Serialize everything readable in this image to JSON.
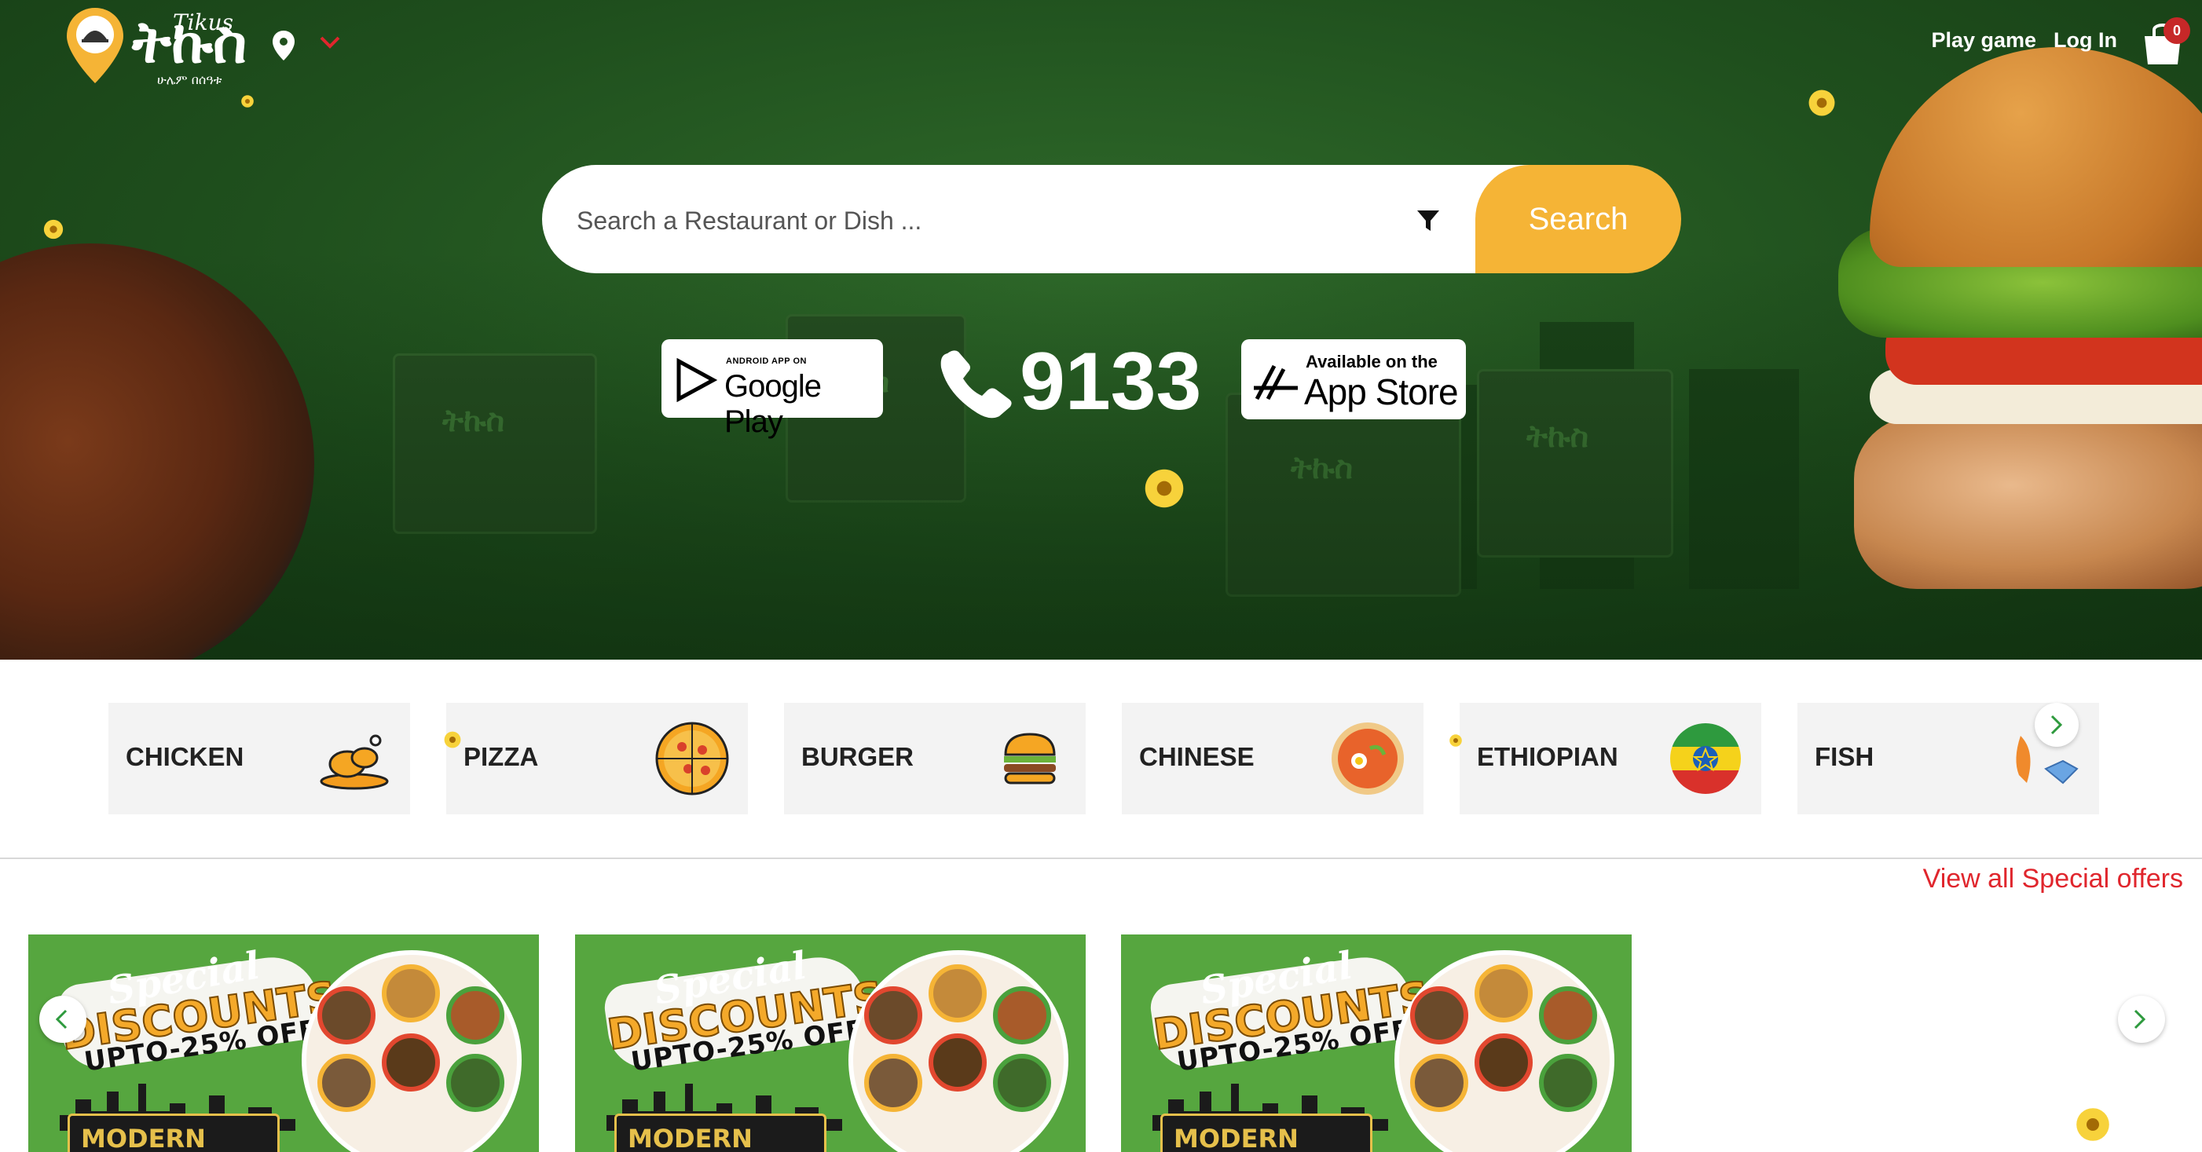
{
  "brand": {
    "logo_amharic": "ትኩስ",
    "logo_latin": "Tikus",
    "logo_tagline": "ሁሌም በሰዓቱ"
  },
  "header": {
    "links": [
      "Play game",
      "Log In"
    ],
    "cart_count": "0"
  },
  "search": {
    "placeholder": "Search a Restaurant or Dish ...",
    "button_label": "Search"
  },
  "apps": {
    "google_play_small": "ANDROID APP ON",
    "google_play_big": "Google Play",
    "app_store_small": "Available on the",
    "app_store_big": "App Store",
    "phone_number": "9133"
  },
  "categories": [
    {
      "label": "CHICKEN",
      "icon": "chicken-icon"
    },
    {
      "label": "PIZZA",
      "icon": "pizza-icon"
    },
    {
      "label": "BURGER",
      "icon": "burger-icon"
    },
    {
      "label": "CHINESE",
      "icon": "noodle-bowl-icon"
    },
    {
      "label": "ETHIOPIAN",
      "icon": "ethiopian-flag-icon"
    },
    {
      "label": "FISH",
      "icon": "fish-icon"
    }
  ],
  "offers": {
    "view_all_label": "View all Special offers",
    "cards": [
      {
        "special": "Special",
        "headline": "DISCOUNTS",
        "subline": "UPTO-25% OFF",
        "brand": "MODERN Addis"
      },
      {
        "special": "Special",
        "headline": "DISCOUNTS",
        "subline": "UPTO-25% OFF",
        "brand": "MODERN Addis"
      },
      {
        "special": "Special",
        "headline": "DISCOUNTS",
        "subline": "UPTO-25% OFF",
        "brand": "MODERN Addis"
      }
    ]
  },
  "colors": {
    "hero_green": "#1f4f1d",
    "accent_yellow": "#f5b436",
    "link_red": "#e0262d",
    "offer_green": "#56a63f"
  }
}
